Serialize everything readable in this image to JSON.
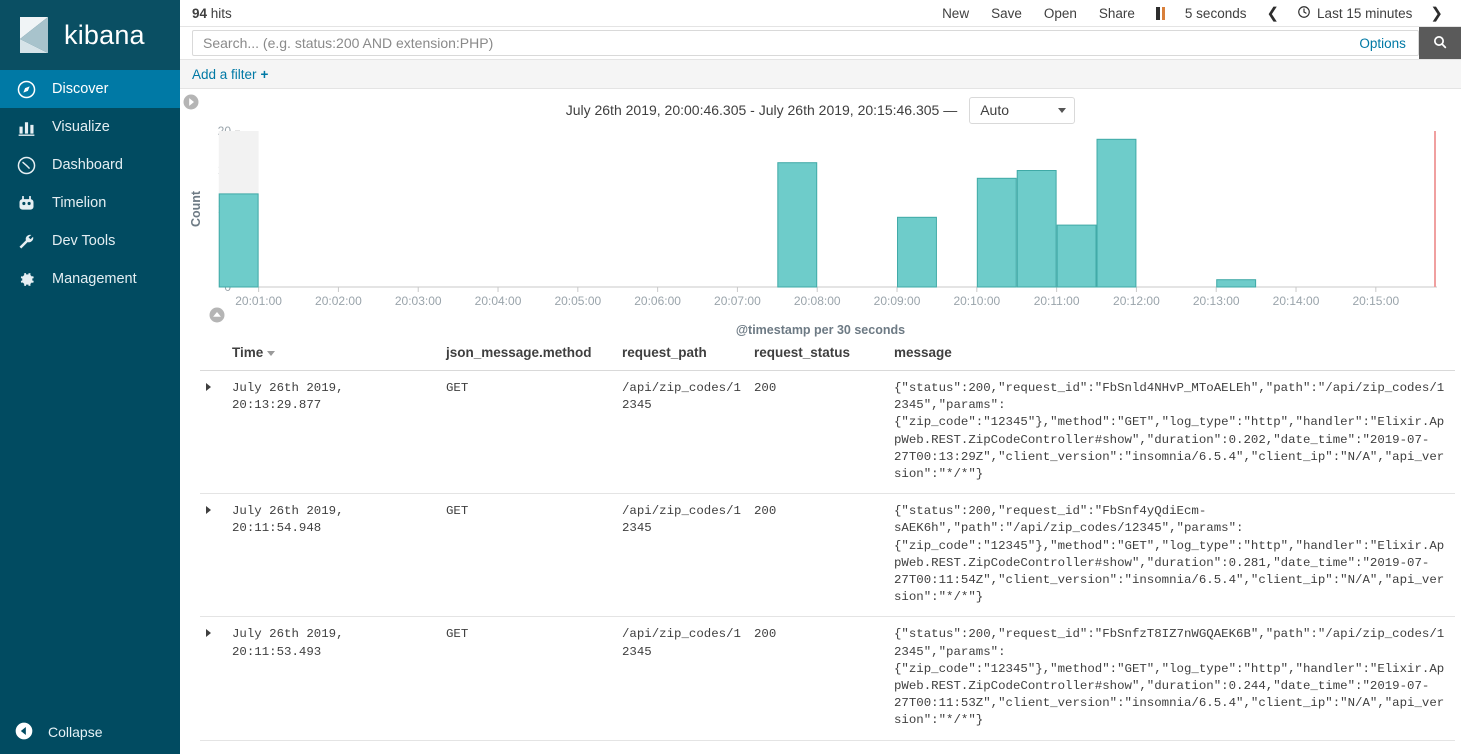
{
  "sidebar": {
    "brand": "kibana",
    "items": [
      {
        "label": "Discover",
        "icon": "compass-icon",
        "active": true
      },
      {
        "label": "Visualize",
        "icon": "bar-chart-icon",
        "active": false
      },
      {
        "label": "Dashboard",
        "icon": "dashboard-gauge-icon",
        "active": false
      },
      {
        "label": "Timelion",
        "icon": "timelion-icon",
        "active": false
      },
      {
        "label": "Dev Tools",
        "icon": "wrench-icon",
        "active": false
      },
      {
        "label": "Management",
        "icon": "gear-icon",
        "active": false
      }
    ],
    "collapse": {
      "label": "Collapse",
      "icon": "chevron-left-circle-icon"
    }
  },
  "topbar": {
    "hits_count": "94",
    "hits_label": "hits",
    "new_label": "New",
    "save_label": "Save",
    "open_label": "Open",
    "share_label": "Share",
    "pause_icon": "pause-icon",
    "refresh_interval": "5 seconds",
    "prev_icon": "chevron-left-icon",
    "clock_icon": "clock-icon",
    "time_range": "Last 15 minutes",
    "next_icon": "chevron-right-icon"
  },
  "search": {
    "value": "",
    "placeholder": "Search... (e.g. status:200 AND extension:PHP)",
    "options_label": "Options",
    "search_icon": "search-icon"
  },
  "filterbar": {
    "add_filter_label": "Add a filter",
    "plus": "+"
  },
  "chart_header": {
    "range_text": "July 26th 2019, 20:00:46.305 - July 26th 2019, 20:15:46.305 —",
    "interval_value": "Auto",
    "toggle_left_icon": "chevron-right-circle-icon",
    "toggle_bottom_icon": "chevron-up-circle-icon"
  },
  "chart_data": {
    "type": "bar",
    "title": "",
    "xlabel": "@timestamp per 30 seconds",
    "ylabel": "Count",
    "ylim": [
      0,
      20
    ],
    "yticks": [
      0,
      5,
      10,
      15,
      20
    ],
    "xticks": [
      "20:01:00",
      "20:02:00",
      "20:03:00",
      "20:04:00",
      "20:05:00",
      "20:06:00",
      "20:07:00",
      "20:08:00",
      "20:09:00",
      "20:10:00",
      "20:11:00",
      "20:12:00",
      "20:13:00",
      "20:14:00",
      "20:15:00"
    ],
    "x_start": "20:00:46",
    "x_end": "20:15:46",
    "bar_color": "#6eccca",
    "bar_stroke": "#3fa9a6",
    "hover_color": "#f2f2f2",
    "now_marker_color": "#f0a0a0",
    "grid": false,
    "legend": "none",
    "categories": [
      "20:00:30",
      "20:07:30",
      "20:09:00",
      "20:10:00",
      "20:10:30",
      "20:11:00",
      "20:11:30",
      "20:13:00"
    ],
    "values": [
      12,
      16,
      9,
      14,
      15,
      8,
      19,
      1
    ],
    "hovered_index": 0
  },
  "table": {
    "columns": [
      {
        "key": "time",
        "label": "Time",
        "sorted": true
      },
      {
        "key": "method",
        "label": "json_message.method",
        "sorted": false
      },
      {
        "key": "path",
        "label": "request_path",
        "sorted": false
      },
      {
        "key": "status",
        "label": "request_status",
        "sorted": false
      },
      {
        "key": "message",
        "label": "message",
        "sorted": false
      }
    ],
    "rows": [
      {
        "time": "July 26th 2019, 20:13:29.877",
        "method": "GET",
        "path": "/api/zip_codes/12345",
        "status": "200",
        "message": "{\"status\":200,\"request_id\":\"FbSnld4NHvP_MToAELEh\",\"path\":\"/api/zip_codes/12345\",\"params\":{\"zip_code\":\"12345\"},\"method\":\"GET\",\"log_type\":\"http\",\"handler\":\"Elixir.AppWeb.REST.ZipCodeController#show\",\"duration\":0.202,\"date_time\":\"2019-07-27T00:13:29Z\",\"client_version\":\"insomnia/6.5.4\",\"client_ip\":\"N/A\",\"api_version\":\"*/*\"}"
      },
      {
        "time": "July 26th 2019, 20:11:54.948",
        "method": "GET",
        "path": "/api/zip_codes/12345",
        "status": "200",
        "message": "{\"status\":200,\"request_id\":\"FbSnf4yQdiEcm-sAEK6h\",\"path\":\"/api/zip_codes/12345\",\"params\":{\"zip_code\":\"12345\"},\"method\":\"GET\",\"log_type\":\"http\",\"handler\":\"Elixir.AppWeb.REST.ZipCodeController#show\",\"duration\":0.281,\"date_time\":\"2019-07-27T00:11:54Z\",\"client_version\":\"insomnia/6.5.4\",\"client_ip\":\"N/A\",\"api_version\":\"*/*\"}"
      },
      {
        "time": "July 26th 2019, 20:11:53.493",
        "method": "GET",
        "path": "/api/zip_codes/12345",
        "status": "200",
        "message": "{\"status\":200,\"request_id\":\"FbSnfzT8IZ7nWGQAEK6B\",\"path\":\"/api/zip_codes/12345\",\"params\":{\"zip_code\":\"12345\"},\"method\":\"GET\",\"log_type\":\"http\",\"handler\":\"Elixir.AppWeb.REST.ZipCodeController#show\",\"duration\":0.244,\"date_time\":\"2019-07-27T00:11:53Z\",\"client_version\":\"insomnia/6.5.4\",\"client_ip\":\"N/A\",\"api_version\":\"*/*\"}"
      }
    ]
  },
  "colors": {
    "sidebar_bg": "#014b61",
    "sidebar_active": "#0079a5",
    "link": "#0079a5",
    "accent_teal": "#6eccca"
  }
}
